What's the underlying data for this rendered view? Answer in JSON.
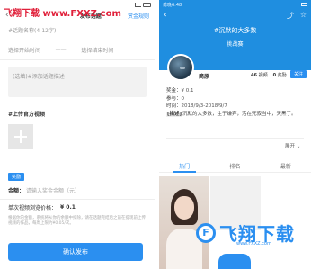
{
  "watermark": {
    "site": "飞翔下载",
    "url": "www.FXXZ.com"
  },
  "left": {
    "status_time": "",
    "nav": {
      "back_icon": "arrow-left-icon",
      "title": "发布话题",
      "rule": "赏金规则"
    },
    "topic_name_placeholder": "#话题名称(4-12字)",
    "start_time_placeholder": "选择开始时间",
    "time_sep": "——",
    "end_time_placeholder": "选择结束时间",
    "desc_placeholder": "(选填)#添加话题描述",
    "upload_label": "#上传官方视频",
    "upload_icon": "plus-icon",
    "reward_tag": "奖励",
    "amount_label": "金额：",
    "amount_placeholder": "请输入奖金金额（元）",
    "price_label": "单次视频浏览价格：",
    "price_value": "¥ 0.1",
    "note": "根据你的金额，系统将从你的余额中扣除，请在话题完结后之前在提现前上传视频的作品，每周上限约¥0.05/次。",
    "confirm_button": "确认发布"
  },
  "right": {
    "status_time": "傍晚6:48",
    "nav_icons": [
      "arrow-left-icon",
      "share-icon",
      "star-icon"
    ],
    "hero_title": "#沉默的大多数",
    "hero_sub": "挑战赛",
    "user_name": "简原",
    "stats": [
      {
        "value": "46",
        "label": "视频"
      },
      {
        "value": "0",
        "label": "奖励"
      }
    ],
    "follow_label": "关注",
    "info": [
      {
        "k": "奖金：",
        "v": "¥ 0.1"
      },
      {
        "k": "参与：",
        "v": "0"
      },
      {
        "k": "时间：",
        "v": "2018/9/3-2018/9/7"
      }
    ],
    "desc_tag": "[描述]",
    "desc_text": "沉默的大多数，生于嫌弃，活在死寂当中，天黑了。",
    "expand_label": "展开",
    "tabs": [
      "热门",
      "排名",
      "最新"
    ],
    "active_tab": 0
  }
}
